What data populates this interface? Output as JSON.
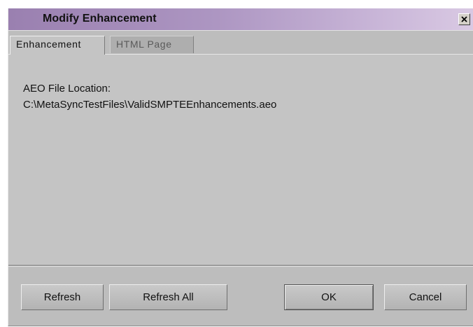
{
  "window": {
    "title": "Modify Enhancement",
    "close_glyph": "✕"
  },
  "tabs": [
    {
      "label": "Enhancement",
      "active": true
    },
    {
      "label": "HTML Page",
      "active": false
    }
  ],
  "content": {
    "label": "AEO File Location:",
    "path": "C:\\MetaSyncTestFiles\\ValidSMPTEEnhancements.aeo"
  },
  "buttons": {
    "refresh": "Refresh",
    "refresh_all": "Refresh All",
    "ok": "OK",
    "cancel": "Cancel"
  },
  "colors": {
    "titlebar_start": "#9a80b0",
    "titlebar_end": "#d9c9e3",
    "dialog_background": "#bdbdbd"
  }
}
